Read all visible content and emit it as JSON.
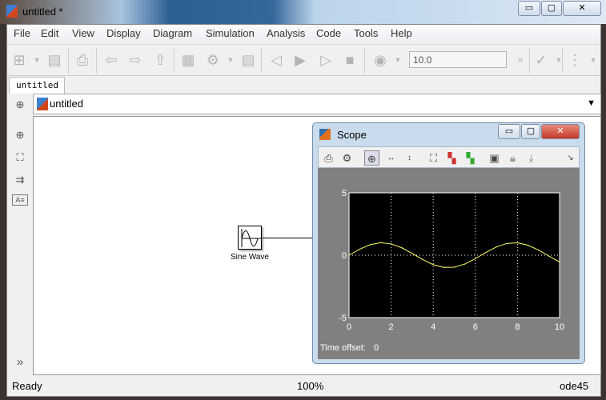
{
  "window": {
    "title": "untitled *",
    "controls": [
      "minimize",
      "maximize",
      "close"
    ]
  },
  "menu": [
    "File",
    "Edit",
    "View",
    "Display",
    "Diagram",
    "Simulation",
    "Analysis",
    "Code",
    "Tools",
    "Help"
  ],
  "toolbar": {
    "stop_time": "10.0",
    "overflow": "»"
  },
  "tab": {
    "label": "untitled"
  },
  "address": {
    "label": "untitled"
  },
  "palette": {
    "more": "»"
  },
  "block": {
    "label": "Sine Wave"
  },
  "status": {
    "left": "Ready",
    "zoom": "100%",
    "solver": "ode45"
  },
  "scope": {
    "title": "Scope",
    "time_offset_label": "Time offset:",
    "time_offset_value": "0"
  },
  "colors": {
    "plot_bg": "#000000",
    "trace": "#ffff66",
    "panel": "#808080"
  },
  "chart_data": {
    "type": "line",
    "title": "",
    "xlabel": "",
    "ylabel": "",
    "xlim": [
      0,
      10
    ],
    "ylim": [
      -5,
      5
    ],
    "grid": true,
    "xticks": [
      "0",
      "2",
      "4",
      "6",
      "8",
      "10"
    ],
    "yticks": [
      "5",
      "0",
      "-5"
    ],
    "x": [
      0,
      0.5,
      1,
      1.5,
      2,
      2.5,
      3,
      3.5,
      4,
      4.5,
      5,
      5.5,
      6,
      6.5,
      7,
      7.5,
      8,
      8.5,
      9,
      9.5,
      10
    ],
    "series": [
      {
        "name": "Sine Wave",
        "values": [
          0,
          0.48,
          0.84,
          1.0,
          0.91,
          0.6,
          0.14,
          -0.35,
          -0.76,
          -0.98,
          -0.96,
          -0.71,
          -0.28,
          0.22,
          0.66,
          0.94,
          0.99,
          0.8,
          0.41,
          -0.08,
          -0.54
        ]
      }
    ]
  }
}
